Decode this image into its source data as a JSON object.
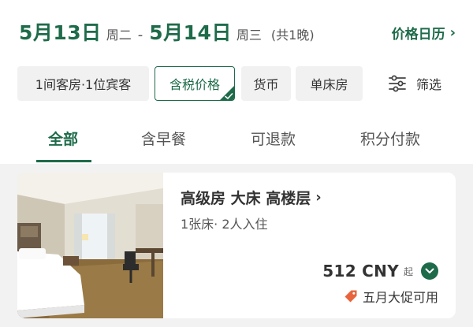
{
  "dates": {
    "checkin": "5月13日",
    "checkin_week": "周二",
    "separator": "-",
    "checkout": "5月14日",
    "checkout_week": "周三",
    "nights": "(共1晚)"
  },
  "price_calendar": {
    "label": "价格日历",
    "icon": "chevron-right-icon"
  },
  "chips": [
    {
      "label": "1间客房·1位宾客",
      "selected": false
    },
    {
      "label": "含税价格",
      "selected": true
    },
    {
      "label": "货币",
      "selected": false
    },
    {
      "label": "单床房",
      "selected": false
    }
  ],
  "filter": {
    "label": "筛选",
    "icon": "sliders-icon"
  },
  "tabs": [
    {
      "label": "全部",
      "active": true
    },
    {
      "label": "含早餐",
      "active": false
    },
    {
      "label": "可退款",
      "active": false
    },
    {
      "label": "积分付款",
      "active": false
    }
  ],
  "room": {
    "title": "高级房 大床 高楼层",
    "subtitle": "1张床· 2人入住",
    "price": "512 CNY",
    "price_suffix": "起",
    "promo": "五月大促可用",
    "promo_icon": "tag-icon",
    "expand_icon": "chevron-down-icon"
  },
  "colors": {
    "accent": "#1e6b4a",
    "promo_tag": "#e8643c",
    "chip_bg": "#f1f1f1",
    "list_bg": "#f2f2f2"
  }
}
